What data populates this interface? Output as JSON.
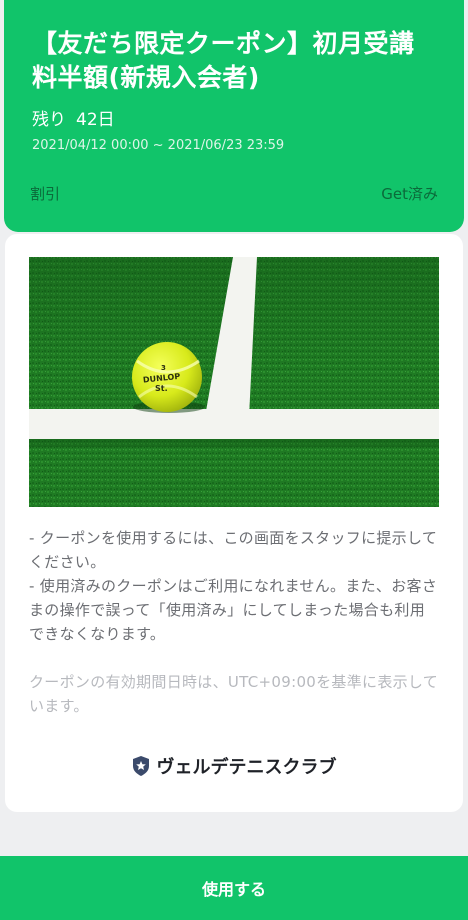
{
  "coupon": {
    "title": "【友だち限定クーポン】初月受講料半額(新規入会者)",
    "remaining_label": "残り",
    "remaining_days": "42日",
    "period": "2021/04/12 00:00 ~ 2021/06/23 23:59",
    "type": "割引",
    "status": "Get済み"
  },
  "content": {
    "image_alt": "tennis-ball-on-court",
    "notes": [
      "- クーポンを使用するには、この画面をスタッフに提示してください。",
      "- 使用済みのクーポンはご利用になれません。また、お客さまの操作で誤って「使用済み」にしてしまった場合も利用できなくなります。"
    ],
    "timezone_note": "クーポンの有効期間日時は、UTC+09:00を基準に表示しています。"
  },
  "brand": {
    "name": "ヴェルデテニスクラブ",
    "icon": "star-shield-icon"
  },
  "actions": {
    "use_button": "使用する"
  },
  "colors": {
    "primary_green": "#11c46a",
    "status_text": "#0b6a3a",
    "background": "#eeeff1"
  }
}
